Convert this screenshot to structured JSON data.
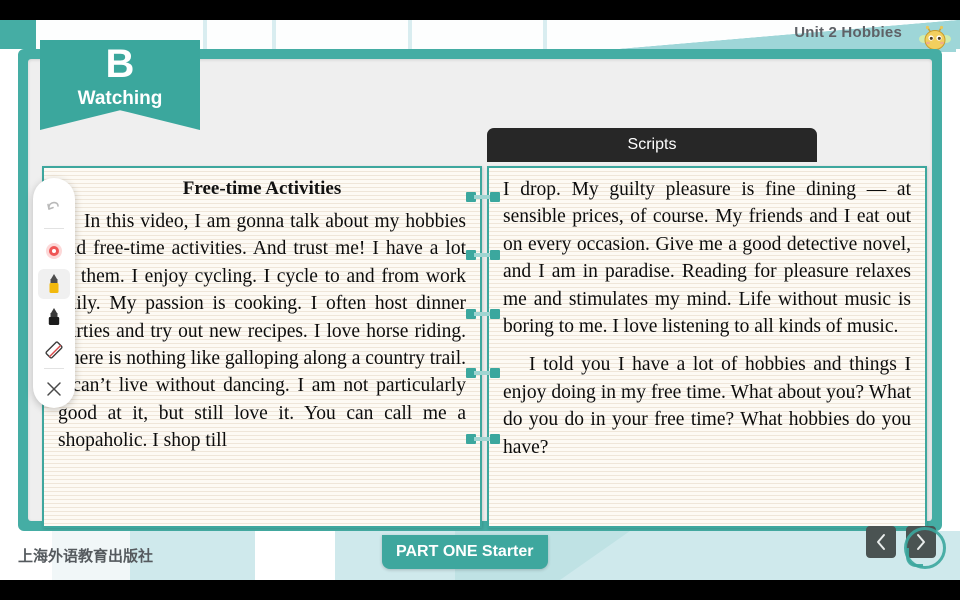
{
  "header": {
    "unit_title": "Unit 2 Hobbies",
    "mascot_icon": "bee-icon",
    "tabs": [
      "",
      "",
      "",
      "",
      ""
    ]
  },
  "section_flag": {
    "letter": "B",
    "label": "Watching"
  },
  "left_panel": {
    "title": "Free-time Activities",
    "paragraphs": [
      "In this video, I am gonna talk about my hobbies and free-time activities. And trust me! I have a lot of them. I enjoy cycling. I cycle to and from work daily. My passion is cooking. I often host dinner parties and try out new recipes. I love horse riding. There is nothing like galloping along a country trail. I can’t live without dancing. I am not particularly good at it, but still love it. You can call me a shopaholic. I shop till"
    ]
  },
  "right_panel": {
    "header_label": "Scripts",
    "paragraphs": [
      "I drop. My guilty pleasure is fine dining — at sensible prices, of course. My friends and I eat out on every occasion. Give me a good detective novel, and I am in paradise. Reading for pleasure relaxes me and stimulates my mind. Life without music is boring to me. I love listening to all kinds of music.",
      "I told you I have a lot of hobbies and things I enjoy doing in my free time. What about you? What do you do in your free time? What hobbies do you have?"
    ]
  },
  "toolbar": {
    "items": [
      {
        "name": "undo-icon",
        "label": "Undo"
      },
      {
        "name": "laser-pointer-icon",
        "label": "Laser pointer"
      },
      {
        "name": "highlighter-icon",
        "label": "Highlighter",
        "selected": true
      },
      {
        "name": "pen-icon",
        "label": "Pen"
      },
      {
        "name": "eraser-icon",
        "label": "Eraser"
      },
      {
        "name": "close-icon",
        "label": "Close"
      }
    ]
  },
  "footer": {
    "publisher": "上海外语教育出版社",
    "part_label": "PART ONE Starter",
    "prev_icon": "chevron-left-icon",
    "next_icon": "chevron-right-icon"
  },
  "colors": {
    "teal": "#3ea79e",
    "teal_light": "#9ed6d8",
    "paper": "#fdfaf4",
    "dark_header": "#272727"
  }
}
